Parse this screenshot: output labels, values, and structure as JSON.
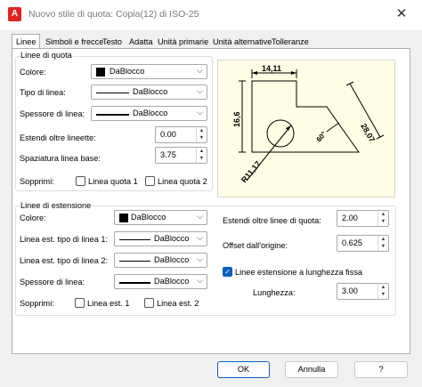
{
  "window": {
    "title": "Nuovo stile di quota: Copia(12) di ISO-25",
    "app_icon_letter": "A",
    "close_glyph": "✕"
  },
  "tabs": [
    {
      "label": "Linee"
    },
    {
      "label": "Simboli e frecce"
    },
    {
      "label": "Testo"
    },
    {
      "label": "Adatta"
    },
    {
      "label": "Unità primarie"
    },
    {
      "label": "Unità alternative"
    },
    {
      "label": "Tolleranze"
    }
  ],
  "dim_lines": {
    "title": "Linee di quota",
    "color_label": "Colore:",
    "color_value": "DaBlocco",
    "linetype_label": "Tipo di linea:",
    "linetype_value": "DaBlocco",
    "lineweight_label": "Spessore di linea:",
    "lineweight_value": "DaBlocco",
    "extend_label": "Estendi oltre lineette:",
    "extend_value": "0.00",
    "baseline_label": "Spaziatura linea base:",
    "baseline_value": "3.75",
    "suppress_label": "Sopprimi:",
    "suppress_1": "Linea quota 1",
    "suppress_2": "Linea quota 2"
  },
  "ext_lines": {
    "title": "Linee di estensione",
    "color_label": "Colore:",
    "color_value": "DaBlocco",
    "lt1_label": "Linea est. tipo di linea 1:",
    "lt1_value": "DaBlocco",
    "lt2_label": "Linea est. tipo di linea 2:",
    "lt2_value": "DaBlocco",
    "lineweight_label": "Spessore di linea:",
    "lineweight_value": "DaBlocco",
    "suppress_label": "Sopprimi:",
    "suppress_1": "Linea est. 1",
    "suppress_2": "Linea est. 2",
    "extend_label": "Estendi oltre linee di quota:",
    "extend_value": "2.00",
    "offset_label": "Offset dall'origine:",
    "offset_value": "0.625",
    "fixed_label": "Linee estensione a lunghezza fissa",
    "fixed_checked": true,
    "length_label": "Lunghezza:",
    "length_value": "3.00"
  },
  "preview": {
    "dim_top": "14,11",
    "dim_left": "16,6",
    "dim_right": "28,07",
    "dim_angle": "60°",
    "dim_radius": "R11,17"
  },
  "buttons": {
    "ok": "OK",
    "cancel": "Annulla",
    "help": "?"
  },
  "colors": {
    "accent": "#0a5fbf",
    "preview_bg": "#fffde5",
    "app_icon": "#e02424"
  }
}
